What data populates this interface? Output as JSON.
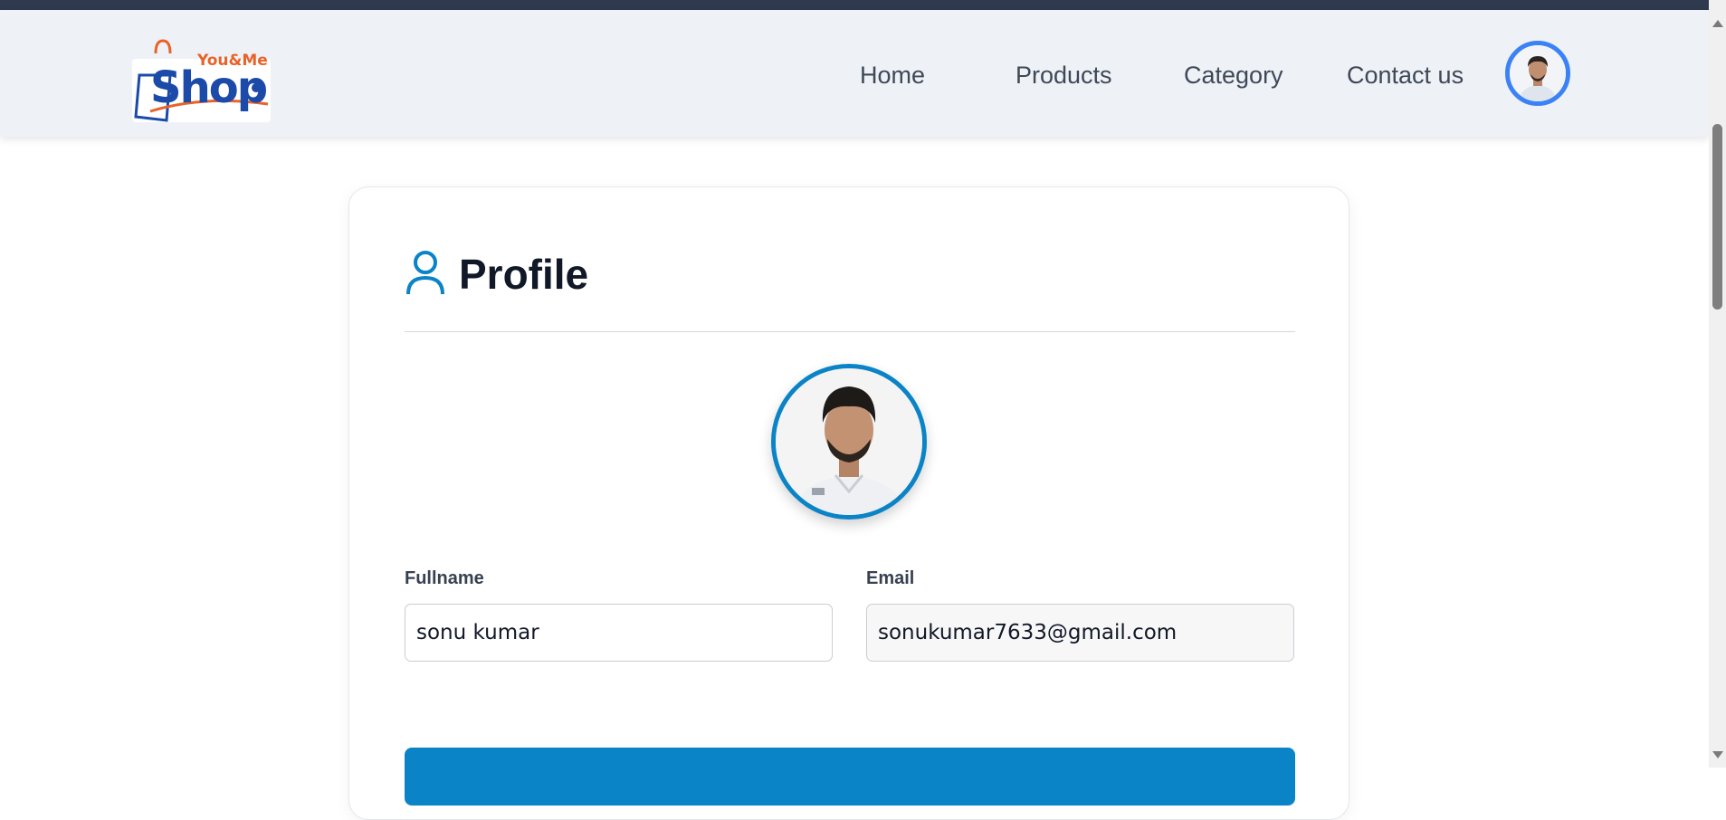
{
  "logo": {
    "small_text": "You&Me",
    "big_text": "Shop"
  },
  "nav": {
    "items": [
      {
        "label": "Home"
      },
      {
        "label": "Products"
      },
      {
        "label": "Category"
      },
      {
        "label": "Contact us"
      }
    ],
    "avatar_icon": "user-avatar"
  },
  "profile": {
    "icon": "user-outline-icon",
    "title": "Profile",
    "avatar_icon": "profile-photo",
    "fields": {
      "fullname": {
        "label": "Fullname",
        "value": "sonu kumar"
      },
      "email": {
        "label": "Email",
        "value": "sonukumar7633@gmail.com"
      }
    }
  },
  "colors": {
    "accent": "#0a84c6",
    "nav_bg": "#eef2f7",
    "nav_avatar_ring": "#3b82f6",
    "logo_blue": "#1b4aa8",
    "logo_orange": "#e8622a"
  }
}
